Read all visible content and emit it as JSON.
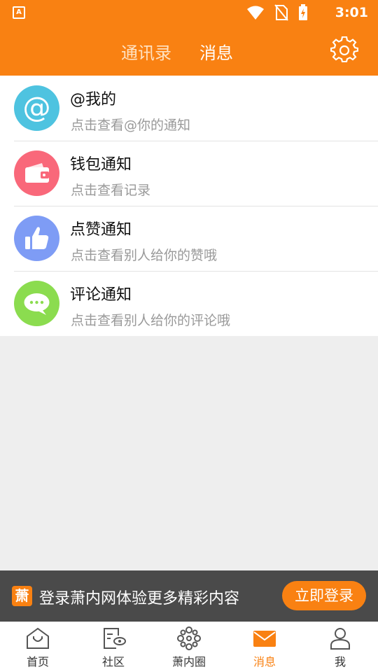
{
  "status_bar": {
    "app_badge": "A",
    "time": "3:01"
  },
  "header": {
    "tabs": [
      {
        "label": "通讯录",
        "active": false
      },
      {
        "label": "消息",
        "active": true
      }
    ]
  },
  "messages": [
    {
      "title": "@我的",
      "subtitle": "点击查看@你的通知",
      "icon": "at-icon",
      "color": "#4ec3e0"
    },
    {
      "title": "钱包通知",
      "subtitle": "点击查看记录",
      "icon": "wallet-icon",
      "color": "#f9687a"
    },
    {
      "title": "点赞通知",
      "subtitle": "点击查看别人给你的赞哦",
      "icon": "thumbs-up-icon",
      "color": "#7e9cf5"
    },
    {
      "title": "评论通知",
      "subtitle": "点击查看别人给你的评论哦",
      "icon": "comment-icon",
      "color": "#8bdc4f"
    }
  ],
  "login_banner": {
    "logo": "萧",
    "message": "登录萧内网体验更多精彩内容",
    "button": "立即登录"
  },
  "bottom_nav": [
    {
      "label": "首页",
      "icon": "home-icon"
    },
    {
      "label": "社区",
      "icon": "community-icon"
    },
    {
      "label": "萧内圈",
      "icon": "circle-icon"
    },
    {
      "label": "消息",
      "icon": "mail-icon",
      "active": true
    },
    {
      "label": "我",
      "icon": "person-icon"
    }
  ],
  "colors": {
    "accent": "#f98112",
    "banner_bg": "#4a4a4a"
  }
}
